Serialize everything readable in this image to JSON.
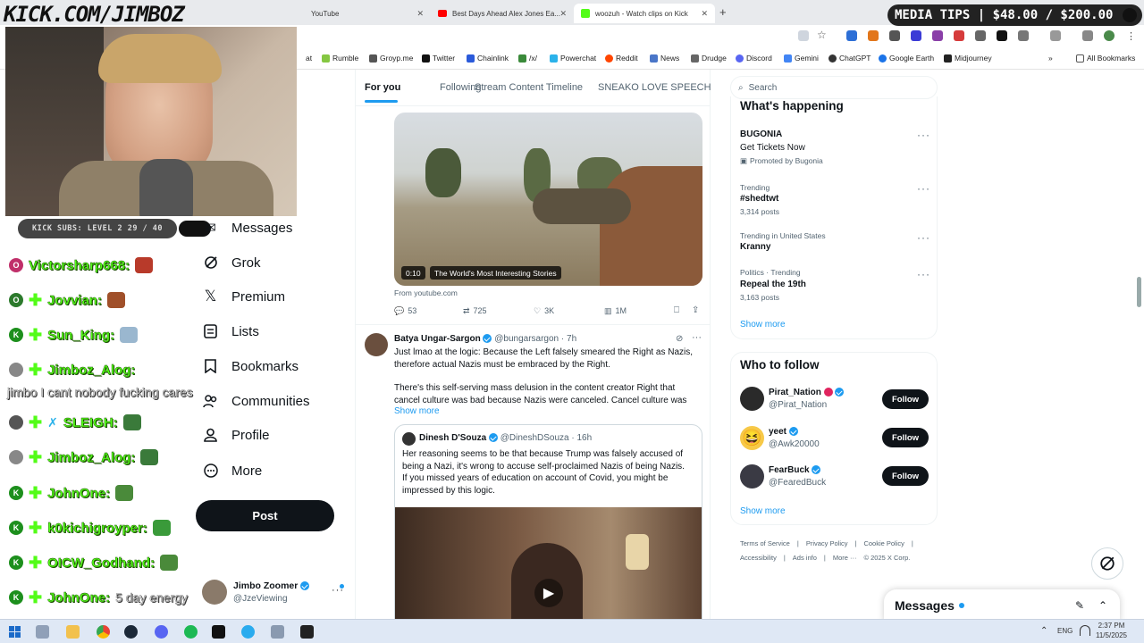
{
  "overlay": {
    "stream_title": "KICK.COM/JIMBOZ",
    "media_tips": "MEDIA TIPS | $48.00 / $200.00",
    "kick_subs": "KICK SUBS: LEVEL 2 29 / 40"
  },
  "chat": [
    {
      "name": "Victorsharp668:",
      "badge_color": "#c0306a",
      "badge": "O"
    },
    {
      "name": "Jovvian:",
      "badge_color": "#2d7a2d",
      "badge": "O"
    },
    {
      "name": "Sun_King:",
      "badge_color": "#1d8f1d",
      "badge": "K"
    },
    {
      "name": "Jimboz_Alog:",
      "badge_color": "#888888",
      "badge": ""
    },
    {
      "name": "SLEIGH:",
      "badge_color": "#555555",
      "badge": ""
    },
    {
      "name": "Jimboz_Alog:",
      "badge_color": "#888888",
      "badge": ""
    },
    {
      "name": "JohnOne:",
      "badge_color": "#1d8f1d",
      "badge": "K"
    },
    {
      "name": "k0kichigroyper:",
      "badge_color": "#1d8f1d",
      "badge": "K"
    },
    {
      "name": "OICW_Godhand:",
      "badge_color": "#1d8f1d",
      "badge": "K"
    },
    {
      "name": "JohnOne:",
      "badge_color": "#1d8f1d",
      "badge": "K",
      "message": "5 day energy"
    }
  ],
  "chat_overlay_message": "jimbo I cant nobody fucking cares",
  "browser": {
    "tabs": [
      {
        "title": "YouTube"
      },
      {
        "title": "Best Days Ahead Alex Jones Ea..."
      },
      {
        "title": "woozuh - Watch clips on Kick"
      }
    ],
    "new_tab": "+",
    "bookmarks": [
      "at",
      "Rumble",
      "Groyp.me",
      "Twitter",
      "Chainlink",
      "/x/",
      "Powerchat",
      "Reddit",
      "News",
      "Drudge",
      "Discord",
      "Gemini",
      "ChatGPT",
      "Google Earth",
      "Midjourney"
    ],
    "all_bookmarks": "All Bookmarks"
  },
  "nav": {
    "items": [
      "Messages",
      "Grok",
      "Premium",
      "Lists",
      "Bookmarks",
      "Communities",
      "Profile",
      "More"
    ],
    "post": "Post",
    "user_name": "Jimbo Zoomer",
    "user_handle": "@JzeViewing"
  },
  "feed": {
    "tabs": [
      "For you",
      "Following",
      "Stream Content Timeline",
      "SNEAKO LOVE SPEECH"
    ],
    "video1": {
      "time": "0:10",
      "caption": "The World's Most Interesting Stories",
      "source": "From youtube.com",
      "replies": "53",
      "reposts": "725",
      "likes": "3K",
      "views": "1M"
    },
    "post2": {
      "name": "Batya Ungar-Sargon",
      "handle": "@bungarsargon",
      "time": "· 7h",
      "text1": "Just lmao at the logic: Because the Left falsely smeared the Right as Nazis,",
      "text2": "therefore actual Nazis must be embraced by the Right.",
      "text3": "There's this self-serving mass delusion in the content creator Right that",
      "text4": "cancel culture was bad because Nazis were canceled. Cancel culture was",
      "show_more": "Show more",
      "quote": {
        "name": "Dinesh D'Souza",
        "handle": "@DineshDSouza",
        "time": "· 16h",
        "text1": "Her reasoning seems to be that because Trump was falsely accused of",
        "text2": "being a Nazi, it's wrong to accuse self-proclaimed Nazis of being Nazis.",
        "text3": "If you missed years of education on account of Covid, you might be",
        "text4": "impressed by this logic."
      }
    }
  },
  "right": {
    "search_placeholder": "Search",
    "happening_title": "What's happening",
    "trends": [
      {
        "meta": "",
        "title": "BUGONIA",
        "sub": "Get Tickets Now",
        "promo": "Promoted by Bugonia"
      },
      {
        "meta": "Trending",
        "title": "#shedtwt",
        "sub": "3,314 posts"
      },
      {
        "meta": "Trending in United States",
        "title": "Kranny",
        "sub": ""
      },
      {
        "meta": "Politics · Trending",
        "title": "Repeal the 19th",
        "sub": "3,163 posts"
      }
    ],
    "show_more": "Show more",
    "who_title": "Who to follow",
    "who": [
      {
        "name": "Pirat_Nation",
        "handle": "@Pirat_Nation",
        "follow": "Follow"
      },
      {
        "name": "yeet",
        "handle": "@Awk20000",
        "follow": "Follow"
      },
      {
        "name": "FearBuck",
        "handle": "@FearedBuck",
        "follow": "Follow"
      }
    ],
    "show_more2": "Show more",
    "footer1": [
      "Terms of Service",
      "Privacy Policy",
      "Cookie Policy"
    ],
    "footer2": [
      "Accessibility",
      "Ads info",
      "More ···",
      "© 2025 X Corp."
    ],
    "messages": "Messages"
  },
  "taskbar": {
    "lang": "ENG",
    "time": "2:37 PM",
    "date": "11/5/2025"
  },
  "colors": {
    "kick_green": "#53fc18",
    "x_blue": "#1d9bf0",
    "x_black": "#0f1419"
  }
}
